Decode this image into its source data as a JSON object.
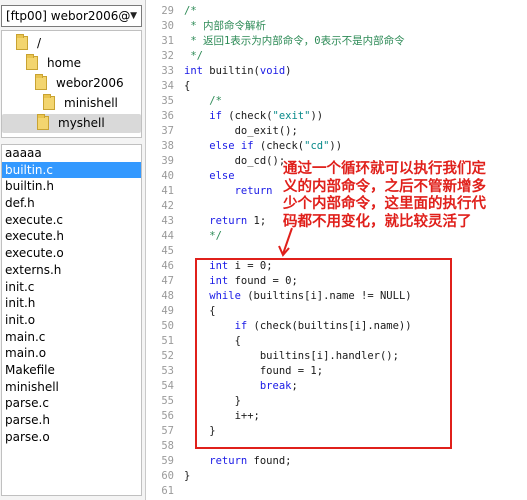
{
  "server_selector": {
    "label": "[ftp00] webor2006@",
    "arrow": "▼"
  },
  "dir_tree": [
    {
      "name": "/",
      "indent": 0
    },
    {
      "name": "home",
      "indent": 1
    },
    {
      "name": "webor2006",
      "indent": 2
    },
    {
      "name": "minishell",
      "indent": 3
    },
    {
      "name": "myshell",
      "indent": 4,
      "selected": true
    }
  ],
  "files": [
    {
      "name": "aaaaa"
    },
    {
      "name": "builtin.c",
      "selected": true
    },
    {
      "name": "builtin.h"
    },
    {
      "name": "def.h"
    },
    {
      "name": "execute.c"
    },
    {
      "name": "execute.h"
    },
    {
      "name": "execute.o"
    },
    {
      "name": "externs.h"
    },
    {
      "name": "init.c"
    },
    {
      "name": "init.h"
    },
    {
      "name": "init.o"
    },
    {
      "name": "main.c"
    },
    {
      "name": "main.o"
    },
    {
      "name": "Makefile"
    },
    {
      "name": "minishell"
    },
    {
      "name": "parse.c"
    },
    {
      "name": "parse.h"
    },
    {
      "name": "parse.o"
    }
  ],
  "code_lines": [
    {
      "n": "29",
      "parts": [
        [
          "cm",
          "/*"
        ]
      ]
    },
    {
      "n": "30",
      "parts": [
        [
          "cm",
          " * 内部命令解析"
        ]
      ]
    },
    {
      "n": "31",
      "parts": [
        [
          "cm",
          " * 返回1表示为内部命令，0表示不是内部命令"
        ]
      ]
    },
    {
      "n": "32",
      "parts": [
        [
          "cm",
          " */"
        ]
      ]
    },
    {
      "n": "33",
      "parts": [
        [
          "kw",
          "int"
        ],
        [
          "tx",
          " builtin("
        ],
        [
          "kw",
          "void"
        ],
        [
          "tx",
          ")"
        ]
      ]
    },
    {
      "n": "34",
      "parts": [
        [
          "tx",
          "{"
        ]
      ]
    },
    {
      "n": "35",
      "parts": [
        [
          "cm",
          "    /*"
        ]
      ]
    },
    {
      "n": "36",
      "parts": [
        [
          "kw",
          "    if"
        ],
        [
          "tx",
          " (check("
        ],
        [
          "st",
          "\"exit\""
        ],
        [
          "tx",
          "))"
        ]
      ]
    },
    {
      "n": "37",
      "parts": [
        [
          "tx",
          "        do_exit();"
        ]
      ]
    },
    {
      "n": "38",
      "parts": [
        [
          "kw",
          "    else if"
        ],
        [
          "tx",
          " (check("
        ],
        [
          "st",
          "\"cd\""
        ],
        [
          "tx",
          "))"
        ]
      ]
    },
    {
      "n": "39",
      "parts": [
        [
          "tx",
          "        do_cd();"
        ]
      ]
    },
    {
      "n": "40",
      "parts": [
        [
          "kw",
          "    else"
        ]
      ]
    },
    {
      "n": "41",
      "parts": [
        [
          "kw",
          "        return"
        ]
      ]
    },
    {
      "n": "42",
      "parts": [
        [
          "tx",
          ""
        ]
      ]
    },
    {
      "n": "43",
      "parts": [
        [
          "kw",
          "    return"
        ],
        [
          "tx",
          " 1;"
        ]
      ]
    },
    {
      "n": "44",
      "parts": [
        [
          "cm",
          "    */"
        ]
      ]
    },
    {
      "n": "45",
      "parts": [
        [
          "tx",
          ""
        ]
      ]
    },
    {
      "n": "46",
      "parts": [
        [
          "kw",
          "    int"
        ],
        [
          "tx",
          " i = 0;"
        ]
      ]
    },
    {
      "n": "47",
      "parts": [
        [
          "kw",
          "    int"
        ],
        [
          "tx",
          " found = 0;"
        ]
      ]
    },
    {
      "n": "48",
      "parts": [
        [
          "kw",
          "    while"
        ],
        [
          "tx",
          " (builtins[i].name != NULL)"
        ]
      ]
    },
    {
      "n": "49",
      "parts": [
        [
          "tx",
          "    {"
        ]
      ]
    },
    {
      "n": "50",
      "parts": [
        [
          "kw",
          "        if"
        ],
        [
          "tx",
          " (check(builtins[i].name))"
        ]
      ]
    },
    {
      "n": "51",
      "parts": [
        [
          "tx",
          "        {"
        ]
      ]
    },
    {
      "n": "52",
      "parts": [
        [
          "tx",
          "            builtins[i].handler();"
        ]
      ]
    },
    {
      "n": "53",
      "parts": [
        [
          "tx",
          "            found = 1;"
        ]
      ]
    },
    {
      "n": "54",
      "parts": [
        [
          "kw",
          "            break"
        ],
        [
          "tx",
          ";"
        ]
      ]
    },
    {
      "n": "55",
      "parts": [
        [
          "tx",
          "        }"
        ]
      ]
    },
    {
      "n": "56",
      "parts": [
        [
          "tx",
          "        i++;"
        ]
      ]
    },
    {
      "n": "57",
      "parts": [
        [
          "tx",
          "    }"
        ]
      ]
    },
    {
      "n": "58",
      "parts": [
        [
          "tx",
          ""
        ]
      ]
    },
    {
      "n": "59",
      "parts": [
        [
          "kw",
          "    return"
        ],
        [
          "tx",
          " found;"
        ]
      ]
    },
    {
      "n": "60",
      "parts": [
        [
          "tx",
          "}"
        ]
      ]
    },
    {
      "n": "61",
      "parts": [
        [
          "tx",
          ""
        ]
      ]
    }
  ],
  "annotation": {
    "lines": [
      "通过一个循环就可以执行我们定",
      "义的内部命令，之后不管新增多",
      "少个内部命令，这里面的执行代",
      "码都不用变化，就比较灵活了"
    ],
    "color": "#e0201b"
  },
  "colors": {
    "selection": "#3399ff",
    "comment": "#2e8b57",
    "keyword": "#1a1ae6",
    "string": "#0a8a8a"
  }
}
